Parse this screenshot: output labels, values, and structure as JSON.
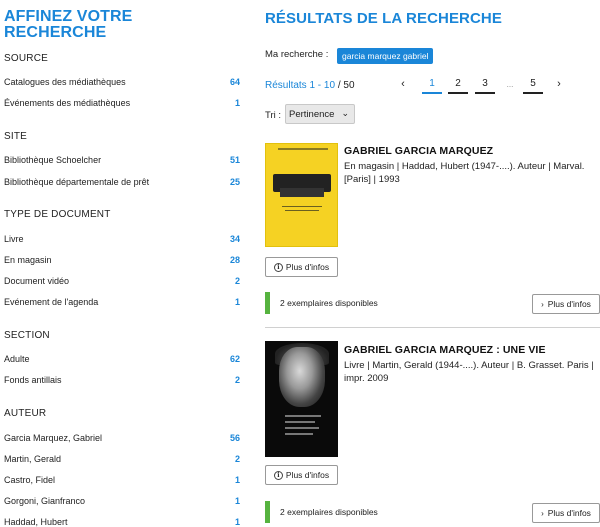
{
  "sidebar": {
    "title": "AFFINEZ VOTRE RECHERCHE",
    "facets": {
      "source": {
        "heading": "SOURCE",
        "items": [
          {
            "label": "Catalogues des médiathèques",
            "count": "64"
          },
          {
            "label": "Événements des médiathèques",
            "count": "1"
          }
        ]
      },
      "site": {
        "heading": "SITE",
        "items": [
          {
            "label": "Bibliothèque Schoelcher",
            "count": "51"
          },
          {
            "label": "Bibliothèque départementale de prêt",
            "count": "25"
          }
        ]
      },
      "doctype": {
        "heading": "TYPE DE DOCUMENT",
        "items": [
          {
            "label": "Livre",
            "count": "34"
          },
          {
            "label": "En magasin",
            "count": "28"
          },
          {
            "label": "Document vidéo",
            "count": "2"
          },
          {
            "label": "Evénement de l'agenda",
            "count": "1"
          }
        ]
      },
      "section": {
        "heading": "SECTION",
        "items": [
          {
            "label": "Adulte",
            "count": "62"
          },
          {
            "label": "Fonds antillais",
            "count": "2"
          }
        ]
      },
      "author": {
        "heading": "AUTEUR",
        "items": [
          {
            "label": "Garcia Marquez, Gabriel",
            "count": "56"
          },
          {
            "label": "Martin, Gerald",
            "count": "2"
          },
          {
            "label": "Castro, Fidel",
            "count": "1"
          },
          {
            "label": "Gorgoni, Gianfranco",
            "count": "1"
          },
          {
            "label": "Haddad, Hubert",
            "count": "1"
          }
        ]
      }
    }
  },
  "main": {
    "title": "RÉSULTATS DE LA RECHERCHE",
    "search_label": "Ma recherche :",
    "search_query": "garcia marquez gabriel",
    "results_range": "Résultats 1 - 10",
    "results_total": " / 50",
    "pagination": {
      "prev": "‹",
      "pages": [
        "1",
        "2",
        "3",
        "5"
      ],
      "dots": "...",
      "next": "›"
    },
    "sort_label": "Tri :",
    "sort_value": "Pertinence",
    "results": [
      {
        "title": "GABRIEL GARCIA MARQUEZ",
        "description": "En magasin | Haddad, Hubert (1947-....). Auteur | Marval. [Paris] | 1993",
        "more_label": "Plus d'infos",
        "availability": "2 exemplaires disponibles",
        "more_label2": "Plus d'infos"
      },
      {
        "title": "GABRIEL GARCIA MARQUEZ : UNE VIE",
        "description": "Livre | Martin, Gerald (1944-....). Auteur | B. Grasset. Paris | impr. 2009",
        "more_label": "Plus d'infos",
        "availability": "2 exemplaires disponibles",
        "more_label2": "Plus d'infos"
      }
    ]
  },
  "colors": {
    "accent": "#1a86d8",
    "available": "#56b33f",
    "cover1": "#f5d223"
  }
}
